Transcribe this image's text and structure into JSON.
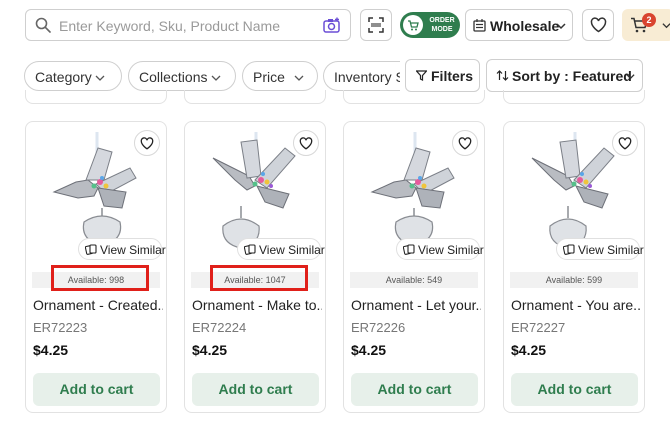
{
  "search": {
    "placeholder": "Enter Keyword, Sku, Product Name",
    "icon": "search-icon",
    "camera_icon": "camera-search-icon"
  },
  "toolbar": {
    "scan_icon": "scan-icon",
    "order_mode_label_line1": "ORDER",
    "order_mode_label_line2": "MODE",
    "wholesale_label": "Wholesale",
    "cart_count": "2",
    "accent_color": "#2f7d4e",
    "badge_color": "#d9442f"
  },
  "filters": {
    "pills": [
      "Category",
      "Collections",
      "Price",
      "Inventory S"
    ],
    "filters_label": "Filters",
    "sort_label": "Sort by : Featured"
  },
  "products": [
    {
      "name": "Ornament - Created...",
      "sku": "ER72223",
      "price": "$4.25",
      "availability": "Available: 998",
      "view_similar": "View Similar",
      "add_to_cart": "Add to cart"
    },
    {
      "name": "Ornament - Make to...",
      "sku": "ER72224",
      "price": "$4.25",
      "availability": "Available: 1047",
      "view_similar": "View Similar",
      "add_to_cart": "Add to cart"
    },
    {
      "name": "Ornament - Let your...",
      "sku": "ER72226",
      "price": "$4.25",
      "availability": "Available: 549",
      "view_similar": "View Similar",
      "add_to_cart": "Add to cart"
    },
    {
      "name": "Ornament - You are...",
      "sku": "ER72227",
      "price": "$4.25",
      "availability": "Available: 599",
      "view_similar": "View Similar",
      "add_to_cart": "Add to cart"
    }
  ],
  "highlight_color": "#e0201a"
}
